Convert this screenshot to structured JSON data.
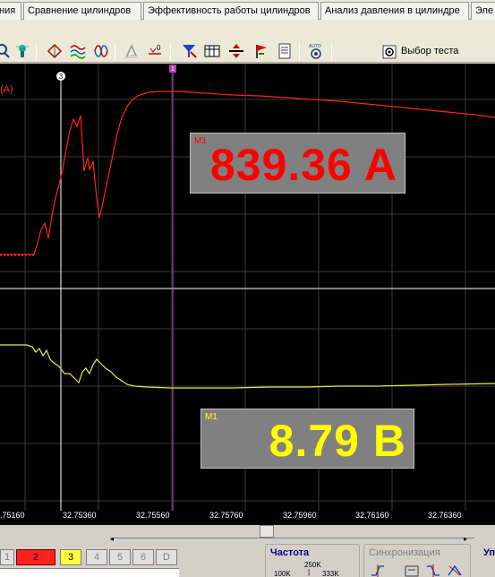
{
  "tabs": [
    {
      "label": "ния",
      "active": false
    },
    {
      "label": "Сравнение цилиндров",
      "active": false
    },
    {
      "label": "Эффективность работы цилиндров",
      "active": false
    },
    {
      "label": "Анализ давления в цилиндре",
      "active": false
    },
    {
      "label": "Эле",
      "active": false
    }
  ],
  "toolbar": {
    "select_test_label": "Выбор теста",
    "icons": [
      "zoom-icon",
      "probe-icon",
      "cursor-icon",
      "waves-icon",
      "lissajous-icon",
      "auto-trigger-icon",
      "zero-offset-icon",
      "filter-icon",
      "table-icon",
      "split-icon",
      "flag-icon",
      "notes-icon",
      "auto-setup-icon"
    ],
    "auto_label": "AUTO",
    "zero_label": "0"
  },
  "scope": {
    "channel1_label": "(A)",
    "cursor_marker": "3",
    "marker_m1": "1",
    "measurement1": {
      "tag": "M1",
      "value": "839.36 A",
      "color": "#ff0000"
    },
    "measurement2": {
      "tag": "M1",
      "value": "8.79 B",
      "color": "#ffff00"
    },
    "x_ticks": [
      ".75160",
      "32.75360",
      "32.75560",
      "32.75760",
      "32.75960",
      "32.76160",
      "32.76360"
    ]
  },
  "bottom": {
    "channels": [
      "1",
      "2",
      "3",
      "4",
      "5",
      "6",
      "D"
    ],
    "frequency_title": "Частота",
    "frequency_value": "250K",
    "frequency_range_low": "100K",
    "frequency_range_high": "333K",
    "sync_title": "Синхронизация",
    "right_title": "Уп"
  },
  "colors": {
    "ch1": "#ff0000",
    "ch2": "#ffff00",
    "grid": "#404040",
    "background": "#000000"
  }
}
